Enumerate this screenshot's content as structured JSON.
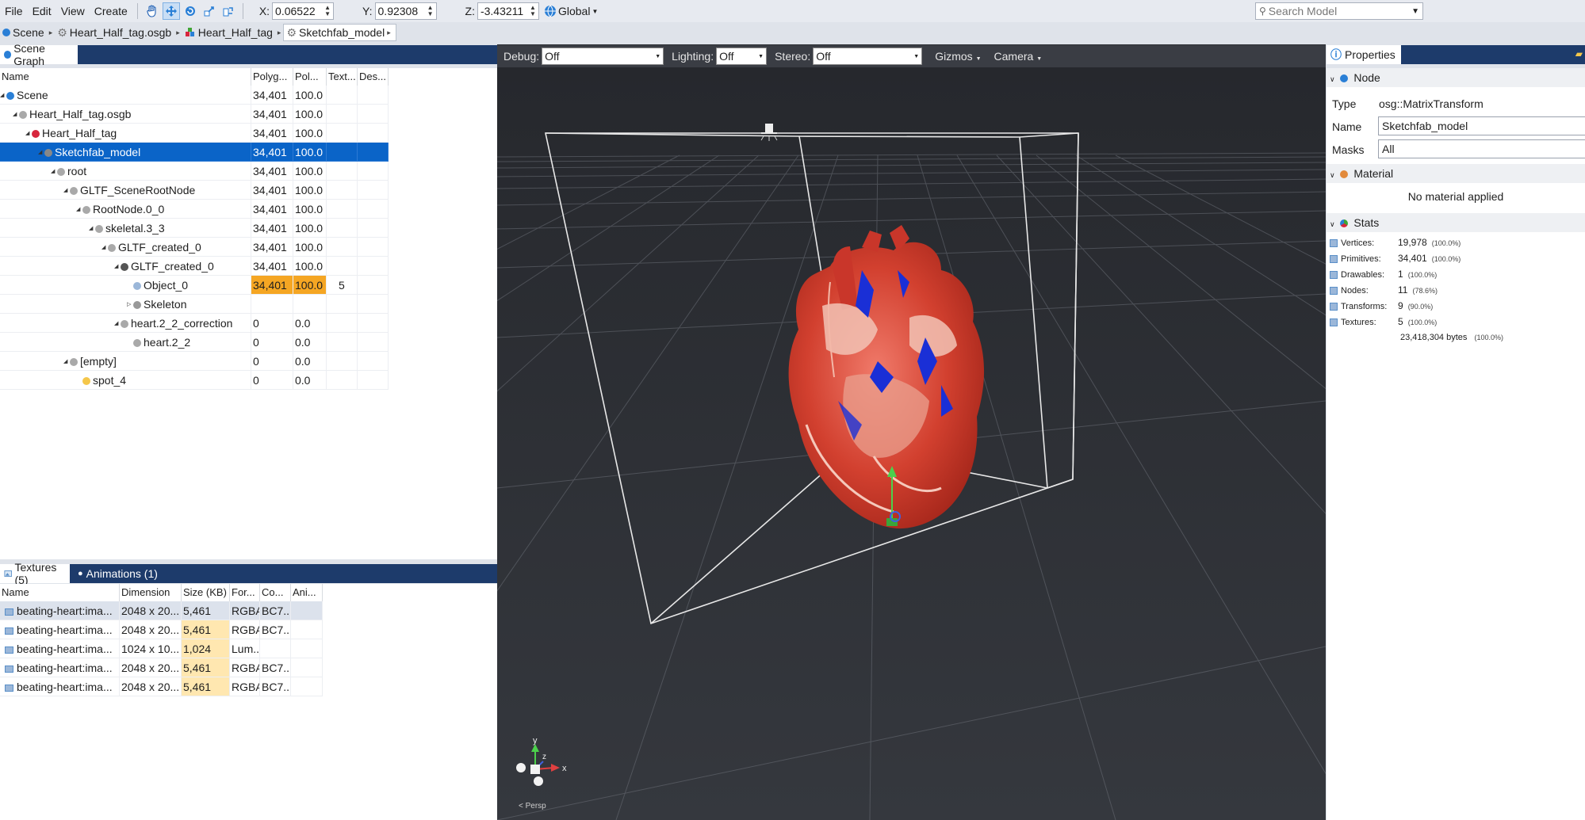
{
  "menu": {
    "file": "File",
    "edit": "Edit",
    "view": "View",
    "create": "Create"
  },
  "transform": {
    "x_label": "X:",
    "x_value": "0.06522",
    "y_label": "Y:",
    "y_value": "0.92308",
    "z_label": "Z:",
    "z_value": "-3.43211",
    "space": "Global"
  },
  "search": {
    "placeholder": "Search Model"
  },
  "breadcrumb": [
    "Scene",
    "Heart_Half_tag.osgb",
    "Heart_Half_tag",
    "Sketchfab_model"
  ],
  "scene_graph": {
    "tab": "Scene Graph",
    "columns": [
      "Name",
      "Polyg...",
      "Pol...",
      "Text...",
      "Des..."
    ],
    "rows": [
      {
        "name": "Scene",
        "polygons": "34,401",
        "percent": "100.0",
        "textures": "",
        "icon": "globe-icon"
      },
      {
        "name": "Heart_Half_tag.osgb",
        "polygons": "34,401",
        "percent": "100.0",
        "textures": "",
        "icon": "node-icon"
      },
      {
        "name": "Heart_Half_tag",
        "polygons": "34,401",
        "percent": "100.0",
        "textures": "",
        "icon": "model-icon"
      },
      {
        "name": "Sketchfab_model",
        "polygons": "34,401",
        "percent": "100.0",
        "textures": "",
        "icon": "transform-icon"
      },
      {
        "name": "root",
        "polygons": "34,401",
        "percent": "100.0",
        "textures": "",
        "icon": "node-icon"
      },
      {
        "name": "GLTF_SceneRootNode",
        "polygons": "34,401",
        "percent": "100.0",
        "textures": "",
        "icon": "node-icon"
      },
      {
        "name": "RootNode.0_0",
        "polygons": "34,401",
        "percent": "100.0",
        "textures": "",
        "icon": "node-icon"
      },
      {
        "name": "skeletal.3_3",
        "polygons": "34,401",
        "percent": "100.0",
        "textures": "",
        "icon": "node-icon"
      },
      {
        "name": "GLTF_created_0",
        "polygons": "34,401",
        "percent": "100.0",
        "textures": "",
        "icon": "node-icon"
      },
      {
        "name": "GLTF_created_0",
        "polygons": "34,401",
        "percent": "100.0",
        "textures": "",
        "icon": "bone-icon"
      },
      {
        "name": "Object_0",
        "polygons": "34,401",
        "percent": "100.0",
        "textures": "5",
        "icon": "mesh-icon"
      },
      {
        "name": "Skeleton",
        "polygons": "",
        "percent": "",
        "textures": "",
        "icon": "skeleton-icon"
      },
      {
        "name": "heart.2_2_correction",
        "polygons": "0",
        "percent": "0.0",
        "textures": "",
        "icon": "node-icon"
      },
      {
        "name": "heart.2_2",
        "polygons": "0",
        "percent": "0.0",
        "textures": "",
        "icon": "node-icon"
      },
      {
        "name": "[empty]",
        "polygons": "0",
        "percent": "0.0",
        "textures": "",
        "icon": "node-icon"
      },
      {
        "name": "spot_4",
        "polygons": "0",
        "percent": "0.0",
        "textures": "",
        "icon": "light-icon"
      }
    ]
  },
  "bottom_tabs": {
    "textures": "Textures (5)",
    "animations": "Animations (1)"
  },
  "textures": {
    "columns": [
      "Name",
      "Dimension",
      "Size (KB)",
      "For...",
      "Co...",
      "Ani..."
    ],
    "rows": [
      {
        "name": "beating-heart:ima...",
        "dimension": "2048 x 20...",
        "size": "5,461",
        "format": "RGBA",
        "compression": "BC7..."
      },
      {
        "name": "beating-heart:ima...",
        "dimension": "2048 x 20...",
        "size": "5,461",
        "format": "RGBA",
        "compression": "BC7..."
      },
      {
        "name": "beating-heart:ima...",
        "dimension": "1024 x 10...",
        "size": "1,024",
        "format": "Lum...",
        "compression": ""
      },
      {
        "name": "beating-heart:ima...",
        "dimension": "2048 x 20...",
        "size": "5,461",
        "format": "RGBA",
        "compression": "BC7..."
      },
      {
        "name": "beating-heart:ima...",
        "dimension": "2048 x 20...",
        "size": "5,461",
        "format": "RGBA",
        "compression": "BC7..."
      }
    ]
  },
  "viewport": {
    "debug_label": "Debug:",
    "debug_value": "Off",
    "lighting_label": "Lighting:",
    "lighting_value": "Off",
    "stereo_label": "Stereo:",
    "stereo_value": "Off",
    "gizmos": "Gizmos",
    "camera": "Camera",
    "projection": "Persp",
    "axis_x": "x",
    "axis_y": "y",
    "axis_z": "z"
  },
  "properties": {
    "tab": "Properties",
    "node_section": "Node",
    "type_label": "Type",
    "type_value": "osg::MatrixTransform",
    "name_label": "Name",
    "name_value": "Sketchfab_model",
    "masks_label": "Masks",
    "masks_value": "All",
    "material_section": "Material",
    "material_text": "No material applied",
    "stats_section": "Stats",
    "stats": [
      {
        "label": "Vertices:",
        "value": "19,978",
        "pct": "(100.0%)"
      },
      {
        "label": "Primitives:",
        "value": "34,401",
        "pct": "(100.0%)"
      },
      {
        "label": "Drawables:",
        "value": "1",
        "pct": "(100.0%)"
      },
      {
        "label": "Nodes:",
        "value": "11",
        "pct": "(78.6%)"
      },
      {
        "label": "Transforms:",
        "value": "9",
        "pct": "(90.0%)"
      },
      {
        "label": "Textures:",
        "value": "5",
        "pct": "(100.0%)"
      }
    ],
    "total_bytes": "23,418,304 bytes",
    "total_pct": "(100.0%)"
  },
  "colors": {
    "selection": "#0a64c8",
    "highlight": "#f5a623",
    "tab_strip": "#1d3b6b",
    "viewport_bg": "#2e3035"
  }
}
